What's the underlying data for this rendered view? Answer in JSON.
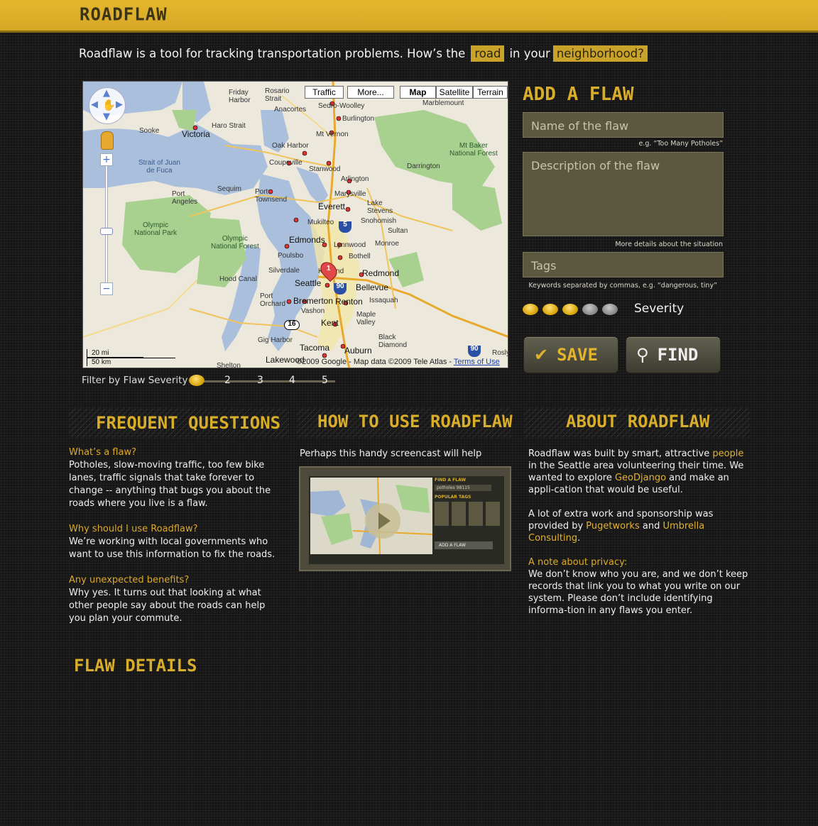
{
  "header": {
    "logo": "ROADFLAW"
  },
  "tagline": {
    "pre": "Roadflaw is a tool for tracking transportation problems. How’s the",
    "road": "road",
    "mid": "in your",
    "neighborhood": "neighborhood?"
  },
  "map": {
    "buttons": {
      "traffic": "Traffic",
      "more": "More...",
      "map": "Map",
      "satellite": "Satellite",
      "terrain": "Terrain"
    },
    "scale": {
      "mi": "20 mi",
      "km": "50 km"
    },
    "copyright": "©2009 Google - Map data ©2009 Tele Atlas - ",
    "terms": "Terms of Use",
    "labels": {
      "friday_harbor": "Friday\nHarbor",
      "rosario": "Rosario\nStrait",
      "sedro": "Sedro-Woolley",
      "marblemount": "Marblemount",
      "burlington": "Burlington",
      "anacortes": "Anacortes",
      "haro": "Haro Strait",
      "victoria": "Victoria",
      "sooke": "Sooke",
      "mt_vernon": "Mt Vernon",
      "mt_baker": "Mt Baker\nNational Forest",
      "oak_harbor": "Oak Harbor",
      "strait": "Strait of Juan\nde Fuca",
      "coupeville": "Coupeville",
      "stanwood": "Stanwood",
      "darrington": "Darrington",
      "arlington": "Arlington",
      "sequim": "Sequim",
      "port_angeles": "Port\nAngeles",
      "port_townsend": "Port\nTownsend",
      "marysville": "Marysville",
      "lake_stevens": "Lake\nStevens",
      "everett": "Everett",
      "snohomish": "Snohomish",
      "mukilteo": "Mukilteo",
      "sultan": "Sultan",
      "olympic_np": "Olympic\nNational Park",
      "olympic_nf": "Olympic\nNational Forest",
      "edmonds": "Edmonds",
      "lynnwood": "Lynnwood",
      "monroe": "Monroe",
      "bothell": "Bothell",
      "poulsbo": "Poulsbo",
      "silverdale": "Silverdale",
      "kirkland": "Kirkland",
      "redmond": "Redmond",
      "hood_canal": "Hood Canal",
      "seattle": "Seattle",
      "bellevue": "Bellevue",
      "port_orchard": "Port\nOrchard",
      "bremerton": "Bremerton",
      "renton": "Renton",
      "issaquah": "Issaquah",
      "vashon": "Vashon",
      "maple_valley": "Maple\nValley",
      "kent": "Kent",
      "gig_harbor": "Gig Harbor",
      "black_diamond": "Black\nDiamond",
      "tacoma": "Tacoma",
      "auburn": "Auburn",
      "lakewood": "Lakewood",
      "shelton": "Shelton",
      "rosly": "Rosly"
    },
    "shields": {
      "i5": "5",
      "i90": "90",
      "r16": "16",
      "i90b": "90"
    },
    "marker": "1"
  },
  "filter": {
    "label": "Filter by Flaw Severity",
    "levels": [
      "2",
      "3",
      "4",
      "5"
    ]
  },
  "add_flaw": {
    "title": "ADD A FLAW",
    "name_placeholder": "Name of the  flaw",
    "name_hint": "e.g. “Too Many Potholes”",
    "desc_placeholder": "Description of the flaw",
    "desc_hint": "More details about the situation",
    "tags_placeholder": "Tags",
    "tags_hint": "Keywords separated by commas, e.g. “dangerous, tiny”",
    "severity_label": "Severity",
    "severity": 3,
    "severity_max": 5,
    "save": "SAVE",
    "find": "FIND"
  },
  "faq": {
    "title": "FREQUENT QUESTIONS",
    "items": [
      {
        "q": "What’s a flaw?",
        "a": "Potholes, slow-moving traffic, too few bike lanes, traffic signals that take forever to change -- anything that bugs you about the roads where you live is a flaw."
      },
      {
        "q": "Why should I use Roadflaw?",
        "a": "We’re working with local governments who want to use this information to fix the roads."
      },
      {
        "q": "Any unexpected benefits?",
        "a": "Why yes.  It turns out that looking at what other people say about the roads can help you plan your commute."
      }
    ]
  },
  "howto": {
    "title": "HOW TO USE ROADFLAW",
    "text": "Perhaps this handy screencast will help",
    "video": {
      "find": "FIND A FLAW",
      "search": "potholes 98115",
      "tags": "POPULAR TAGS",
      "add": "ADD A FLAW"
    }
  },
  "about": {
    "title": "ABOUT ROADFLAW",
    "p1_a": "Roadflaw was built by smart, attractive ",
    "p1_link": "people",
    "p1_b": " in the Seattle area volunteering their time. We wanted to explore ",
    "p1_link2": "GeoDjango",
    "p1_c": " and make an appli-cation that would be useful.",
    "p2_a": "A lot of extra work and sponsorship was provided by ",
    "p2_link1": "Pugetworks",
    "p2_and": " and ",
    "p2_link2": "Umbrella Consulting",
    "p2_dot": ".",
    "privacy_head": "A note about privacy:",
    "privacy": "We don’t know who you are, and we don’t keep records that link you to what you write on our system. Please don’t include identifying informa-tion in any flaws you enter."
  },
  "flaw_details": {
    "title": "FLAW DETAILS"
  },
  "colors": {
    "accent": "#d8ad2a",
    "header": "#e0b42b",
    "background": "#1a1a1a"
  }
}
